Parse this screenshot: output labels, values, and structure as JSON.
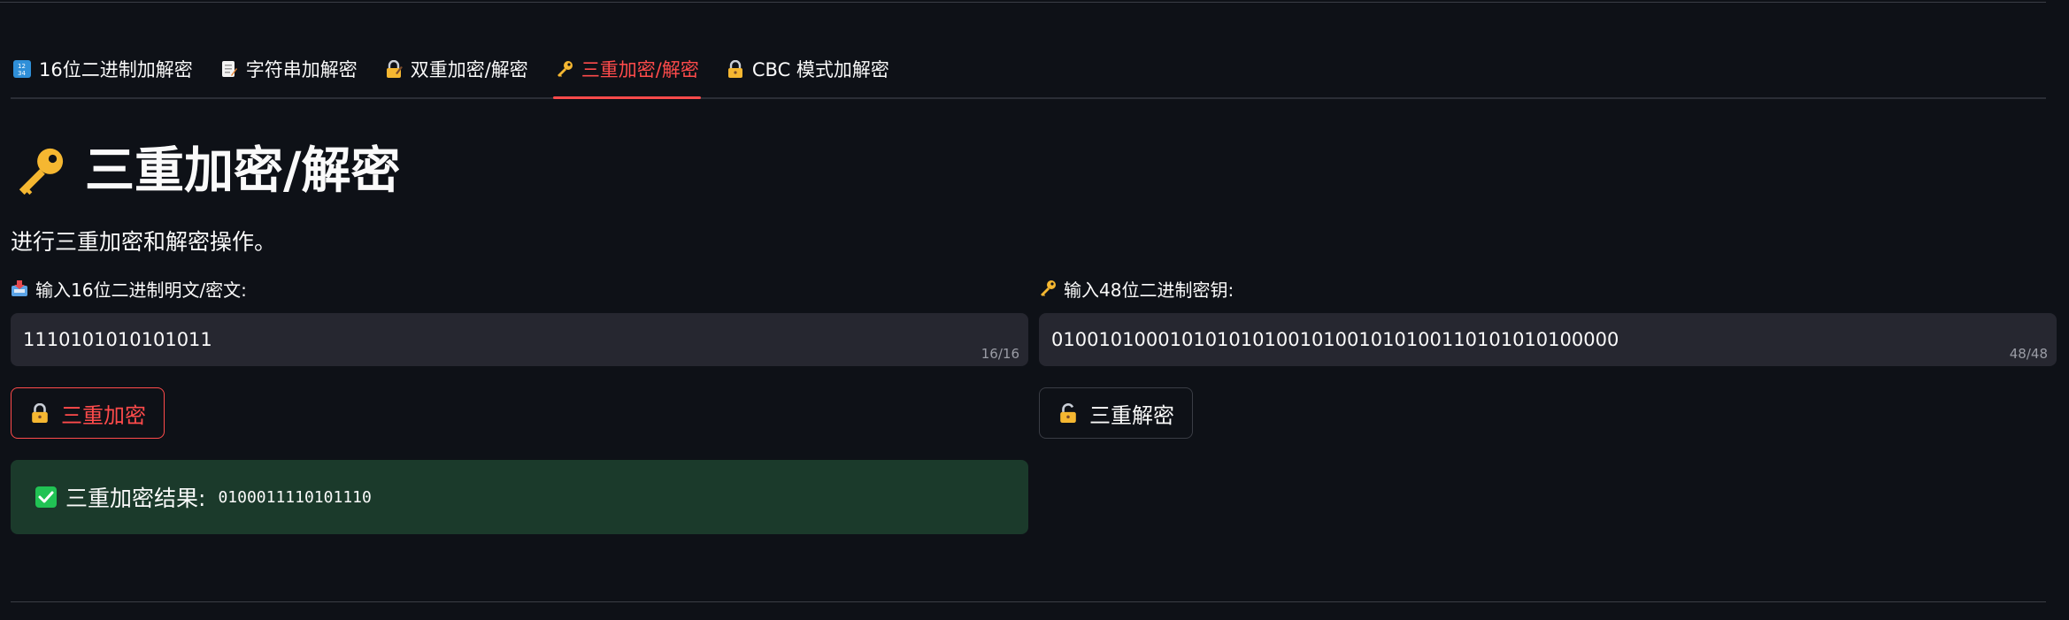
{
  "tabs": [
    {
      "label": "16位二进制加解密",
      "icon": "1234-icon",
      "active": false
    },
    {
      "label": "字符串加解密",
      "icon": "memo-icon",
      "active": false
    },
    {
      "label": "双重加密/解密",
      "icon": "lock-with-pen-icon",
      "active": false
    },
    {
      "label": "三重加密/解密",
      "icon": "key-icon",
      "active": true
    },
    {
      "label": "CBC 模式加解密",
      "icon": "lock-icon",
      "active": false
    }
  ],
  "header": {
    "title": "三重加密/解密",
    "title_icon": "key-icon",
    "subtitle": "进行三重加密和解密操作。"
  },
  "left": {
    "label": "输入16位二进制明文/密文:",
    "label_icon": "inbox-tray-icon",
    "input_value": "1110101010101011",
    "counter": "16/16",
    "button_label": "三重加密",
    "button_icon": "lock-icon",
    "result_label": "三重加密结果:",
    "result_value": "0100011110101110"
  },
  "right": {
    "label": "输入48位二进制密钥:",
    "label_icon": "key-icon",
    "input_value": "010010100010101010100101001010100110101010100000",
    "counter": "48/48",
    "button_label": "三重解密",
    "button_icon": "unlock-icon"
  },
  "colors": {
    "background": "#0e1117",
    "accent": "#ff4b4b",
    "input_bg": "#262730",
    "success_bg": "#1b3a2b",
    "success_check": "#21c354"
  }
}
